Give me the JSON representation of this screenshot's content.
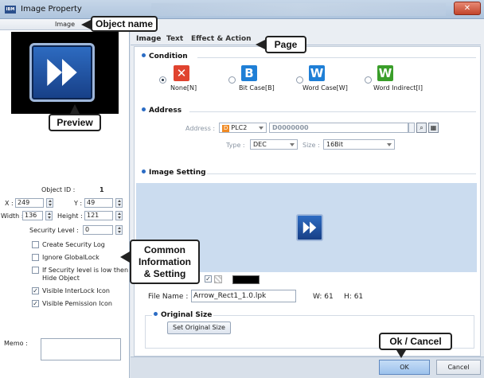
{
  "window": {
    "app_icon": "IBM",
    "title": "Image Property",
    "close_label": "✕"
  },
  "left": {
    "header": "Image",
    "object_id_label": "Object ID :",
    "object_id_value": "1",
    "x_label": "X :",
    "x_value": "249",
    "y_label": "Y :",
    "y_value": "49",
    "width_label": "Width :",
    "width_value": "136",
    "height_label": "Height :",
    "height_value": "121",
    "security_label": "Security Level :",
    "security_value": "0",
    "checkboxes": [
      {
        "label": "Create Security Log",
        "checked": false
      },
      {
        "label": "Ignore GlobalLock",
        "checked": false
      },
      {
        "label": "If Security level is low then",
        "checked": false
      },
      {
        "label": "Hide Object",
        "checked": false
      },
      {
        "label": "Visible InterLock Icon",
        "checked": true
      },
      {
        "label": "Visible Pemission Icon",
        "checked": true
      }
    ],
    "memo_label": "Memo :"
  },
  "tabs": [
    {
      "label": "Image"
    },
    {
      "label": "Text"
    },
    {
      "label": "Effect & Action"
    }
  ],
  "condition": {
    "title": "Condition",
    "options": [
      {
        "label": "None[N]",
        "icon": "x-icon",
        "glyph": "✕",
        "color": "#e0432f",
        "selected": true
      },
      {
        "label": "Bit Case[B]",
        "icon": "b-icon",
        "glyph": "B",
        "color": "#1f7fd6",
        "selected": false
      },
      {
        "label": "Word Case[W]",
        "icon": "w-icon",
        "glyph": "W",
        "color": "#1f7fd6",
        "selected": false
      },
      {
        "label": "Word Indirect[I]",
        "icon": "w-green-icon",
        "glyph": "W",
        "color": "#3a9e2a",
        "selected": false
      }
    ]
  },
  "address": {
    "title": "Address",
    "address_label": "Address :",
    "device_badge": "D",
    "device": "PLC2",
    "address_value": "D0000000",
    "type_label": "Type :",
    "type_value": "DEC",
    "size_label": "Size :",
    "size_value": "16Bit"
  },
  "image_setting": {
    "title": "Image Setting",
    "file_name_label": "File Name :",
    "file_name": "Arrow_Rect1_1.0.lpk",
    "w_label": "W:",
    "w_value": "61",
    "h_label": "H:",
    "h_value": "61"
  },
  "original_size": {
    "title": "Original Size",
    "button_label": "Set Original Size"
  },
  "footer": {
    "ok_label": "OK",
    "cancel_label": "Cancel"
  },
  "callouts": {
    "object_name": "Object name",
    "page": "Page",
    "preview": "Preview",
    "common_line1": "Common",
    "common_line2": "Information",
    "common_line3": "& Setting",
    "ok_cancel": "Ok / Cancel"
  }
}
